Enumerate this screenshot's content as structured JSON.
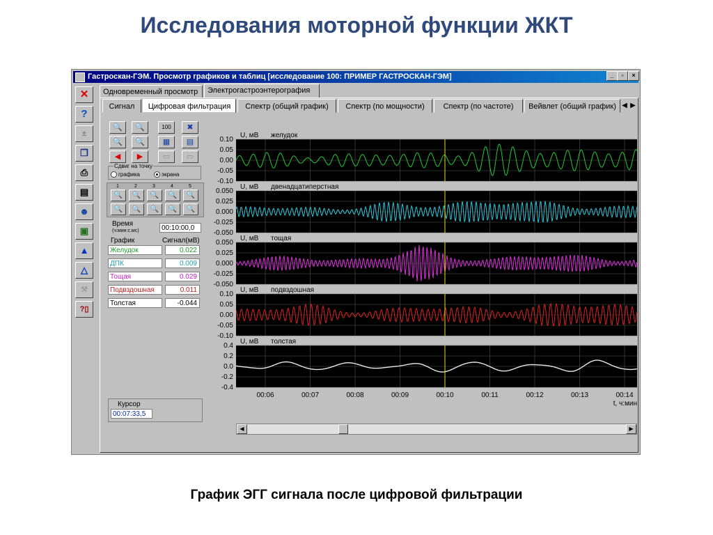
{
  "slide": {
    "title": "Исследования моторной функции ЖКТ",
    "caption": "График ЭГГ сигнала после цифровой фильтрации"
  },
  "window": {
    "title": "Гастроскан-ГЭМ. Просмотр графиков и таблиц [исследование 100: ПРИМЕР ГАСТРОСКАН-ГЭМ]",
    "minimize": "_",
    "maximize": "▫",
    "close": "×"
  },
  "tabs_top": [
    {
      "label": "Одновременный просмотр",
      "active": false
    },
    {
      "label": "Электрогастроэнтерография",
      "active": true
    }
  ],
  "tabs_sub": [
    {
      "label": "Сигнал",
      "active": false
    },
    {
      "label": "Цифровая фильтрация",
      "active": true
    },
    {
      "label": "Спектр (общий график)",
      "active": false
    },
    {
      "label": "Спектр (по мощности)",
      "active": false
    },
    {
      "label": "Спектр (по частоте)",
      "active": false
    },
    {
      "label": "Вейвлет (общий график)",
      "active": false
    }
  ],
  "controls": {
    "shift_group_label": "Сдвиг на точку",
    "radio_graph": "графика",
    "radio_screen": "экрана",
    "zoom_100": "100",
    "time_label": "Время",
    "time_unit": "(ч:мин:с.мс)",
    "time_value": "00:10:00,0",
    "col_graph": "График",
    "col_signal": "Сигнал(мВ)",
    "cursor_label": "Курсор",
    "cursor_value": "00:07:33,5",
    "level_digits": [
      "1",
      "2",
      "3",
      "4",
      "5"
    ]
  },
  "signals": [
    {
      "label": "Желудок",
      "value": "0.022",
      "color": "#1a9c2a"
    },
    {
      "label": "ДПК",
      "value": "0.009",
      "color": "#1fa0b8"
    },
    {
      "label": "Тощая",
      "value": "0.029",
      "color": "#c020c0"
    },
    {
      "label": "Подвздошная",
      "value": "0.011",
      "color": "#c02020"
    },
    {
      "label": "Толстая",
      "value": "-0.044",
      "color": "#000000"
    }
  ],
  "chart_data": {
    "type": "line",
    "x_label": "t, ч:мин",
    "x_ticks": [
      "00:06",
      "00:07",
      "00:08",
      "00:09",
      "00:10",
      "00:11",
      "00:12",
      "00:13",
      "00:14"
    ],
    "cursor_time": "00:10",
    "y_unit_label": "U, мВ",
    "panels": [
      {
        "name": "желудок",
        "color": "#22cc33",
        "ylim": [
          -0.1,
          0.1
        ],
        "yticks": [
          "0.10",
          "0.05",
          "0.00",
          "-0.05",
          "-0.10"
        ]
      },
      {
        "name": "двенадцатиперстная",
        "color": "#2cc8dc",
        "ylim": [
          -0.05,
          0.05
        ],
        "yticks": [
          "0.050",
          "0.025",
          "0.000",
          "-0.025",
          "-0.050"
        ]
      },
      {
        "name": "тощая",
        "color": "#e030e0",
        "ylim": [
          -0.05,
          0.05
        ],
        "yticks": [
          "0.050",
          "0.025",
          "0.000",
          "-0.025",
          "-0.050"
        ]
      },
      {
        "name": "подвздошная",
        "color": "#e02020",
        "ylim": [
          -0.1,
          0.1
        ],
        "yticks": [
          "0.10",
          "0.05",
          "0.00",
          "-0.05",
          "-0.10"
        ]
      },
      {
        "name": "толстая",
        "color": "#e8e8e8",
        "ylim": [
          -0.4,
          0.4
        ],
        "yticks": [
          "0.4",
          "0.2",
          "0.0",
          "-0.2",
          "-0.4"
        ]
      }
    ]
  }
}
